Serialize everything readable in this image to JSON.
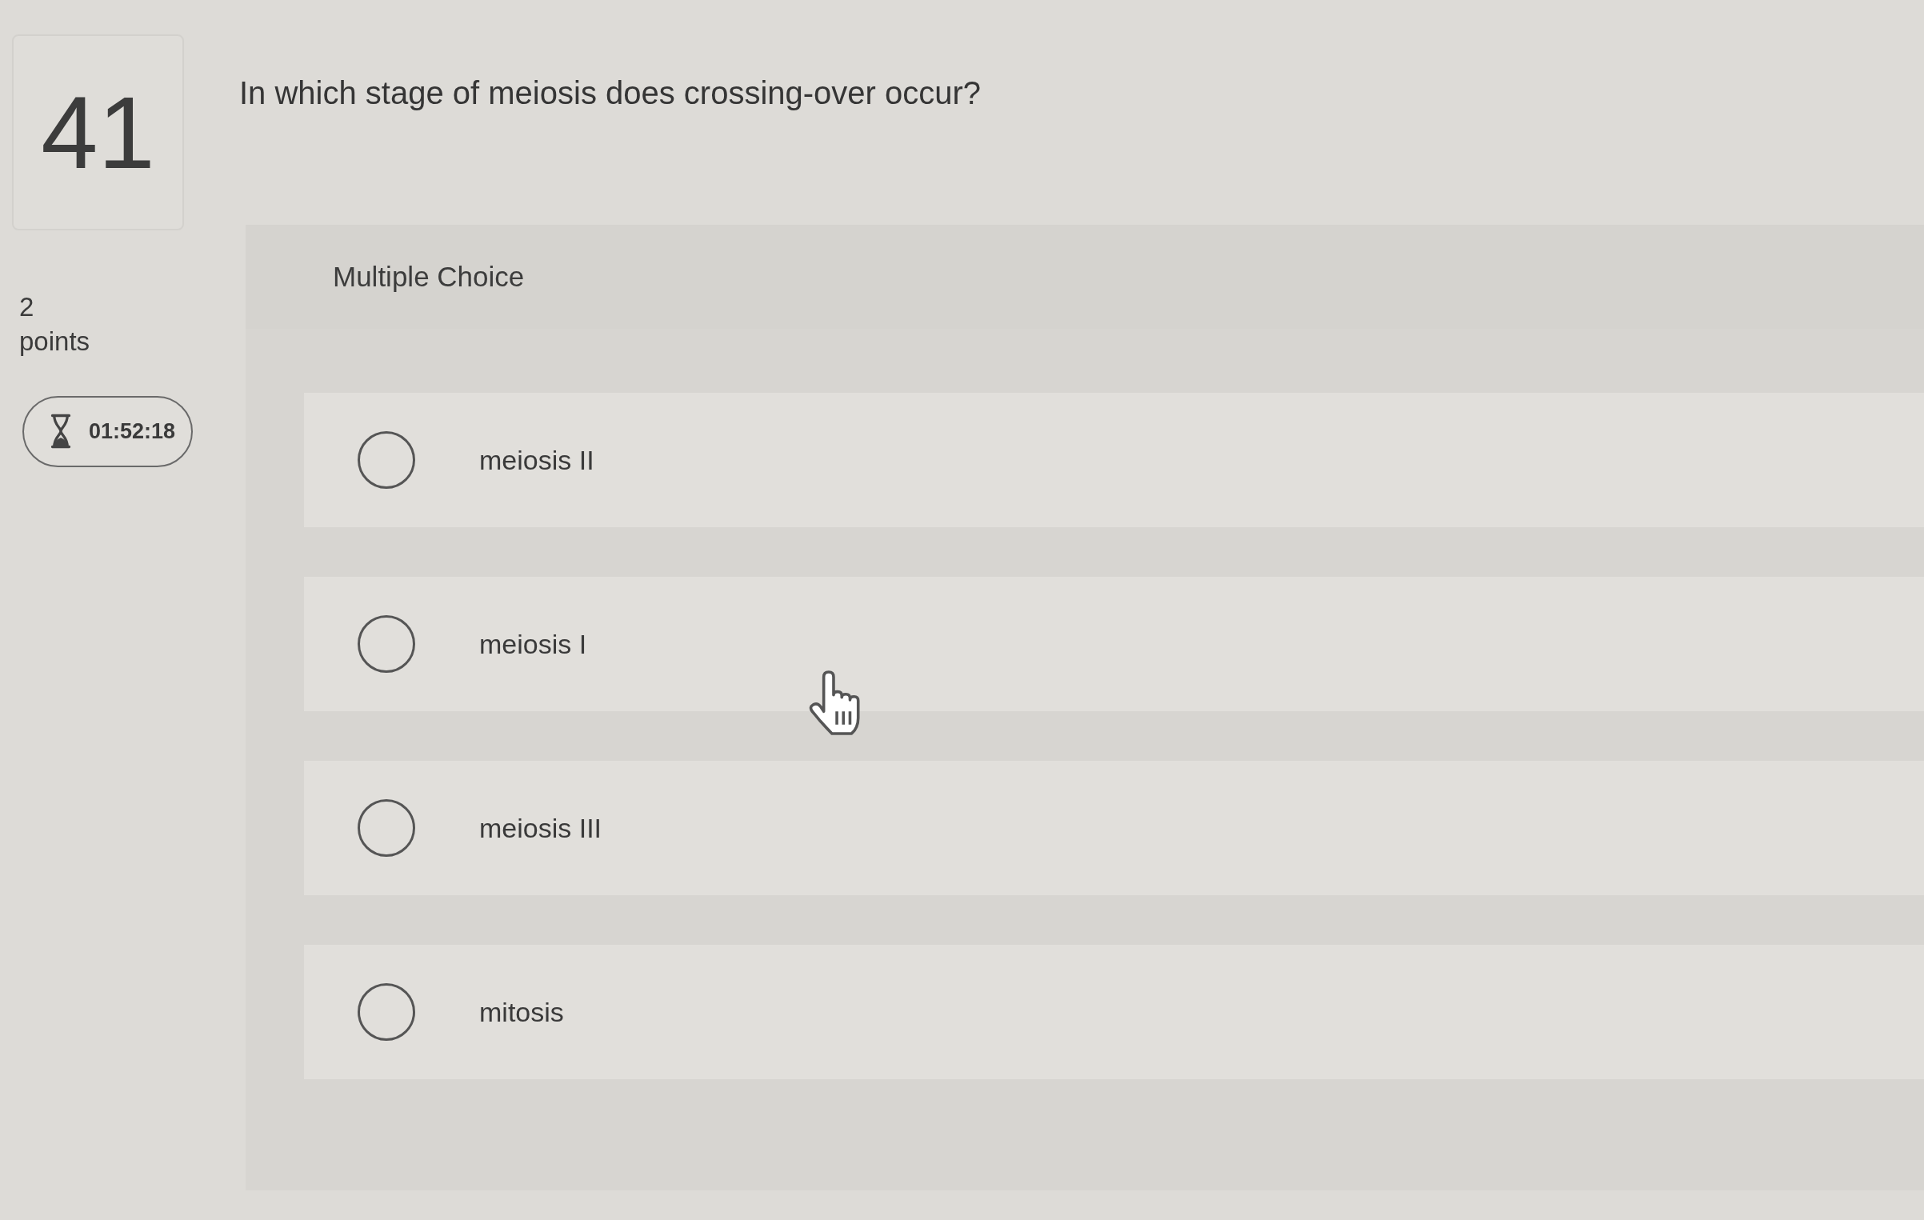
{
  "question": {
    "number": "41",
    "text": "In which stage of meiosis does crossing-over occur?",
    "points": "2",
    "points_label": "points",
    "timer": "01:52:18"
  },
  "answer_panel": {
    "type_label": "Multiple Choice",
    "options": [
      {
        "label": "meiosis II",
        "selected": false
      },
      {
        "label": "meiosis I",
        "selected": false
      },
      {
        "label": "meiosis III",
        "selected": false
      },
      {
        "label": "mitosis",
        "selected": false
      }
    ]
  }
}
